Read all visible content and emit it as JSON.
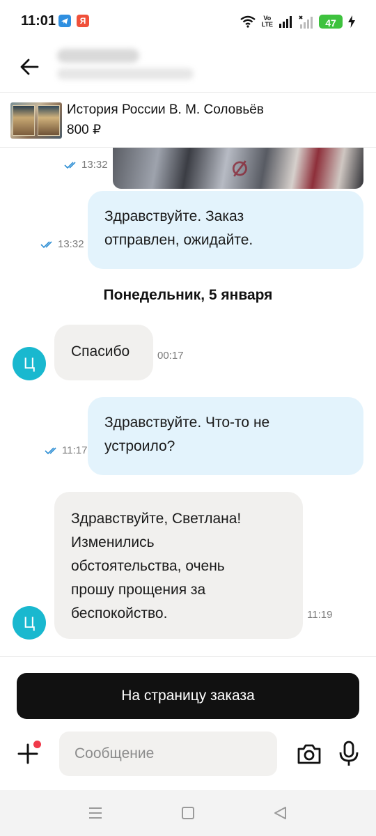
{
  "status_bar": {
    "time": "11:01",
    "app1_icon": "telegram-icon",
    "app2_icon": "yandex-icon",
    "app2_letter": "Я",
    "volte_line1": "Vo",
    "volte_line2": "LTE",
    "battery": "47",
    "battery_color": "#3ec23e"
  },
  "header": {
    "back_icon": "arrow-left-icon"
  },
  "product": {
    "title": "История России В. М. Соловьёв",
    "price": "800 ₽"
  },
  "messages": [
    {
      "type": "image",
      "direction": "out",
      "time": "13:32",
      "status": "read"
    },
    {
      "type": "text",
      "direction": "out",
      "text_lines": [
        "Здравствуйте. Заказ",
        "отправлен, ожидайте."
      ],
      "time": "13:32",
      "status": "read"
    },
    {
      "type": "day_separator",
      "text": "Понедельник, 5 января"
    },
    {
      "type": "text",
      "direction": "in",
      "avatar": "Ц",
      "text_lines": [
        "Спасибо"
      ],
      "time": "00:17"
    },
    {
      "type": "text",
      "direction": "out",
      "text_lines": [
        "Здравствуйте. Что-то не",
        "устроило?"
      ],
      "time": "11:17",
      "status": "read"
    },
    {
      "type": "text",
      "direction": "in",
      "avatar": "Ц",
      "text_lines": [
        "Здравствуйте, Светлана!",
        "Изменились",
        "обстоятельства, очень",
        "прошу прощения за",
        "беспокойство."
      ],
      "time": "11:19"
    }
  ],
  "actions": {
    "order_button": "На страницу заказа"
  },
  "composer": {
    "placeholder": "Сообщение",
    "value": "",
    "attach_icon": "plus-icon",
    "camera_icon": "camera-icon",
    "mic_icon": "microphone-icon",
    "notification_dot_color": "#f03a4a"
  },
  "nav_bar": {
    "recents_icon": "menu-icon",
    "home_icon": "square-icon",
    "back_icon": "triangle-back-icon"
  },
  "colors": {
    "outgoing_bubble": "#e3f3fc",
    "incoming_bubble": "#f1f0ee",
    "avatar": "#19b8cf",
    "read_ticks": "#2f8fd4",
    "primary_button": "#111111"
  }
}
